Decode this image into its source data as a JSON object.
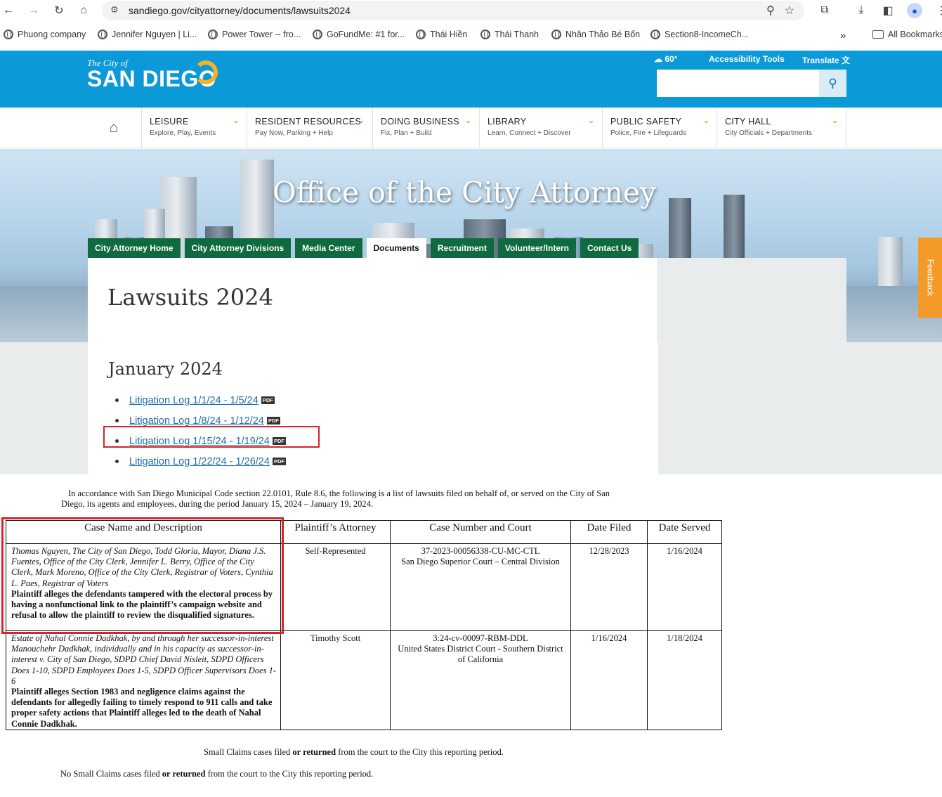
{
  "browser": {
    "url": "sandiego.gov/cityattorney/documents/lawsuits2024",
    "bookmarks": [
      "Phuong company",
      "Jennifer Nguyen | Li...",
      "Power Tower -- fro...",
      "GoFundMe: #1 for...",
      "Thái Hiền",
      "Thái Thanh",
      "Nhân Thảo Bé Bốn",
      "Section8-IncomeCh..."
    ],
    "all_bookmarks": "All Bookmarks",
    "overflow": "»"
  },
  "header": {
    "logo_small": "The City of",
    "logo_big": "SAN DIEGO",
    "weather": "60°",
    "accessibility": "Accessibility Tools",
    "translate": "Translate",
    "search_placeholder": ""
  },
  "nav": [
    {
      "title": "LEISURE",
      "sub": "Explore, Play, Events"
    },
    {
      "title": "RESIDENT RESOURCES",
      "sub": "Pay Now, Parking + Help"
    },
    {
      "title": "DOING BUSINESS",
      "sub": "Fix, Plan + Build"
    },
    {
      "title": "LIBRARY",
      "sub": "Learn, Connect + Discover"
    },
    {
      "title": "PUBLIC SAFETY",
      "sub": "Police, Fire + Lifeguards"
    },
    {
      "title": "CITY HALL",
      "sub": "City Officials + Departments"
    }
  ],
  "hero": {
    "title": "Office of the City Attorney",
    "tabs": [
      "City Attorney Home",
      "City Attorney Divisions",
      "Media Center",
      "Documents",
      "Recruitment",
      "Volunteer/Intern",
      "Contact Us"
    ],
    "active_tab": "Documents",
    "feedback": "Feedback"
  },
  "page": {
    "title": "Lawsuits 2024",
    "section": "January 2024",
    "logs": [
      "Litigation Log 1/1/24 - 1/5/24",
      "Litigation Log 1/8/24 - 1/12/24",
      "Litigation Log 1/15/24 - 1/19/24",
      "Litigation Log 1/22/24 - 1/26/24"
    ],
    "pdf_label": "PDF"
  },
  "document": {
    "intro_line1": "In accordance with San Diego Municipal Code section 22.0101, Rule 8.6, the following is a list of lawsuits filed on behalf of, or served on the City of San",
    "intro_line2": "Diego, its agents and employees, during the period January 15, 2024 – January 19, 2024.",
    "headers": [
      "Case Name and Description",
      "Plaintiff’s Attorney",
      "Case Number and Court",
      "Date Filed",
      "Date Served"
    ],
    "rows": [
      {
        "case_name": "Thomas Nguyen, The City of San Diego, Todd Gloria, Mayor, Diana J.S. Fuentes, Office of the City Clerk, Jennifer L. Berry, Office of the City Clerk, Mark Moreno, Office of the City Clerk, Registrar of Voters, Cynthia L. Paes, Registrar of Voters",
        "description": "Plaintiff alleges the defendants tampered with the electoral process by having a nonfunctional link to the plaintiff’s campaign website and refusal to allow the plaintiff to review the disqualified signatures.",
        "attorney": "Self-Represented",
        "case_number": "37-2023-00056338-CU-MC-CTL",
        "court": "San Diego Superior Court – Central Division",
        "filed": "12/28/2023",
        "served": "1/16/2024"
      },
      {
        "case_name": "Estate of Nahal Connie Dadkhak, by and through her successor-in-interest Manouchehr Dadkhak, individually and in his capacity as successor-in-interest v. City of San Diego, SDPD Chief David Nisleit, SDPD Officers Does 1-10, SDPD Employees Does 1-5, SDPD Officer Supervisors Does 1-6",
        "description": "Plaintiff alleges Section 1983 and negligence claims against the defendants for allegedly failing to timely respond to 911 calls and take proper safety actions that Plaintiff alleges led to the death of Nahal Connie Dadkhak.",
        "attorney": "Timothy Scott",
        "case_number": "3:24-cv-00097-RBM-DDL",
        "court": "United States District Court - Southern District of California",
        "filed": "1/16/2024",
        "served": "1/18/2024"
      }
    ],
    "small_claims_a": "Small Claims cases filed",
    "small_claims_bold": "or returned",
    "small_claims_b": "from the court to the City this reporting period.",
    "no_small_claims_a": "No Small Claims cases filed"
  }
}
